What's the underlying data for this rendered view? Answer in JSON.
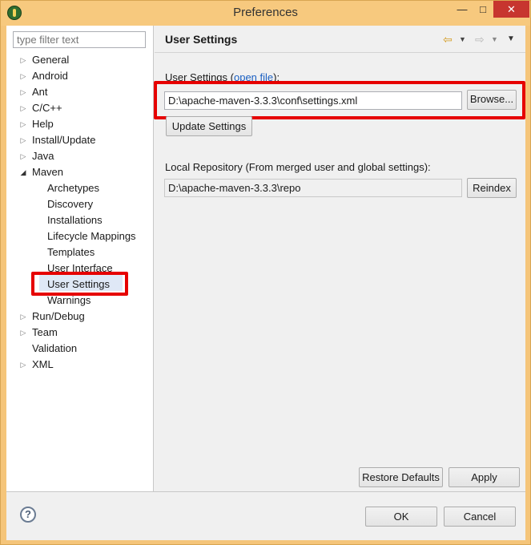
{
  "window": {
    "title": "Preferences",
    "minimize": "—",
    "maximize": "□",
    "close": "✕"
  },
  "filter": {
    "placeholder": "type filter text"
  },
  "tree": [
    {
      "label": "General",
      "arrow": "▷"
    },
    {
      "label": "Android",
      "arrow": "▷"
    },
    {
      "label": "Ant",
      "arrow": "▷"
    },
    {
      "label": "C/C++",
      "arrow": "▷"
    },
    {
      "label": "Help",
      "arrow": "▷"
    },
    {
      "label": "Install/Update",
      "arrow": "▷"
    },
    {
      "label": "Java",
      "arrow": "▷"
    },
    {
      "label": "Maven",
      "arrow": "◢"
    },
    {
      "label": "Archetypes"
    },
    {
      "label": "Discovery"
    },
    {
      "label": "Installations"
    },
    {
      "label": "Lifecycle Mappings"
    },
    {
      "label": "Templates"
    },
    {
      "label": "User Interface"
    },
    {
      "label": "User Settings",
      "selected": true
    },
    {
      "label": "Warnings"
    },
    {
      "label": "Run/Debug",
      "arrow": "▷"
    },
    {
      "label": "Team",
      "arrow": "▷"
    },
    {
      "label": "Validation"
    },
    {
      "label": "XML",
      "arrow": "▷"
    }
  ],
  "page": {
    "title": "User Settings",
    "user_settings_label": "User Settings (",
    "open_file_link": "open file",
    "user_settings_label_end": "):",
    "user_settings_path": "D:\\apache-maven-3.3.3\\conf\\settings.xml",
    "browse_button": "Browse...",
    "update_button": "Update Settings",
    "local_repo_label": "Local Repository (From merged user and global settings):",
    "local_repo_path": "D:\\apache-maven-3.3.3\\repo",
    "reindex_button": "Reindex",
    "restore_defaults_button": "Restore Defaults",
    "apply_button": "Apply"
  },
  "nav": {
    "back_icon": "⇦",
    "forward_icon": "⇨",
    "dropdown": "▼"
  },
  "footer": {
    "help_icon": "?",
    "ok_button": "OK",
    "cancel_button": "Cancel"
  },
  "colors": {
    "highlight": "#e60000",
    "link": "#1a5fc2",
    "titlebar": "#f7c97e",
    "close": "#c7352f"
  }
}
